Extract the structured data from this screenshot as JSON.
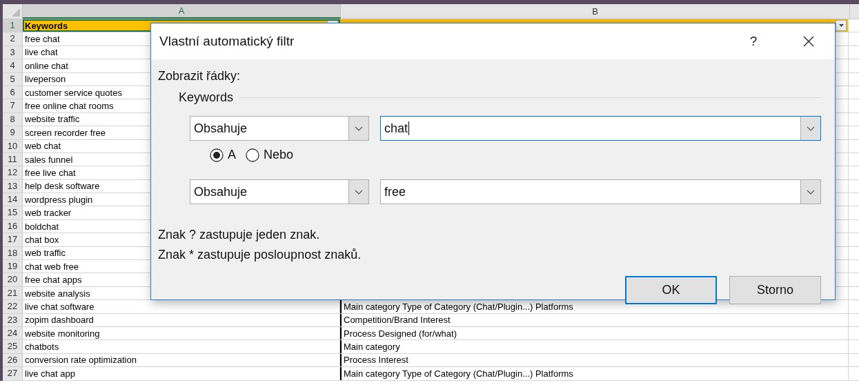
{
  "sheet": {
    "columns": [
      {
        "label": "A",
        "selected": true
      },
      {
        "label": "B",
        "selected": false
      }
    ],
    "header_row": {
      "number": "1",
      "cell_a": "Keywords",
      "selected": true
    },
    "rows": [
      {
        "number": "2",
        "a": "free chat"
      },
      {
        "number": "3",
        "a": "live chat"
      },
      {
        "number": "4",
        "a": "online chat"
      },
      {
        "number": "5",
        "a": "liveperson"
      },
      {
        "number": "6",
        "a": "customer service quotes"
      },
      {
        "number": "7",
        "a": "free online chat rooms"
      },
      {
        "number": "8",
        "a": "website traffic"
      },
      {
        "number": "9",
        "a": "screen recorder free"
      },
      {
        "number": "10",
        "a": "web chat"
      },
      {
        "number": "11",
        "a": "sales funnel"
      },
      {
        "number": "12",
        "a": "free live chat"
      },
      {
        "number": "13",
        "a": "help desk software"
      },
      {
        "number": "14",
        "a": "wordpress plugin"
      },
      {
        "number": "15",
        "a": "web tracker"
      },
      {
        "number": "16",
        "a": "boldchat"
      },
      {
        "number": "17",
        "a": "chat box"
      },
      {
        "number": "18",
        "a": "web traffic"
      },
      {
        "number": "19",
        "a": "chat web free"
      },
      {
        "number": "20",
        "a": "free chat apps"
      },
      {
        "number": "21",
        "a": "website analysis"
      },
      {
        "number": "22",
        "a": "live chat software",
        "b": "Main category Type of Category (Chat/Plugin...) Platforms"
      },
      {
        "number": "23",
        "a": "zopim dashboard",
        "b": "Competition/Brand Interest"
      },
      {
        "number": "24",
        "a": "website monitoring",
        "b": "Process Designed (for/what)"
      },
      {
        "number": "25",
        "a": "chatbots",
        "b": "Main category"
      },
      {
        "number": "26",
        "a": "conversion rate optimization",
        "b": "Process Interest"
      },
      {
        "number": "27",
        "a": "live chat app",
        "b": "Main category Type of Category (Chat/Plugin...) Platforms"
      }
    ]
  },
  "dialog": {
    "title": "Vlastní automatický filtr",
    "help": "?",
    "prompt": "Zobrazit řádky:",
    "group": "Keywords",
    "conditions": [
      {
        "operator": "Obsahuje",
        "value": "chat",
        "focused": true
      },
      {
        "operator": "Obsahuje",
        "value": "free",
        "focused": false
      }
    ],
    "join": [
      {
        "label": "A",
        "selected": true
      },
      {
        "label": "Nebo",
        "selected": false
      }
    ],
    "hints": [
      "Znak ? zastupuje jeden znak.",
      "Znak * zastupuje posloupnost znaků."
    ],
    "buttons": [
      {
        "label": "OK",
        "default": true
      },
      {
        "label": "Storno",
        "default": false
      }
    ]
  }
}
